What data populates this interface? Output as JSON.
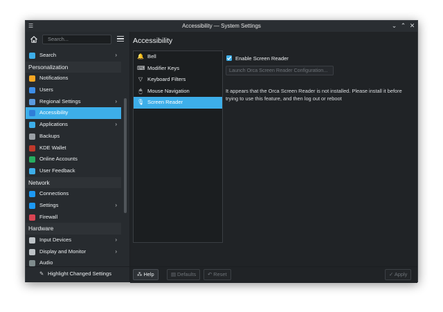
{
  "window": {
    "title": "Accessibility — System Settings"
  },
  "search": {
    "placeholder": "Search..."
  },
  "sidebar": {
    "items": [
      {
        "type": "item",
        "label": "Search",
        "icon": "search-icon",
        "color": "#3daee9",
        "chevron": true
      },
      {
        "type": "header",
        "label": "Personalization"
      },
      {
        "type": "item",
        "label": "Notifications",
        "icon": "bell-icon",
        "color": "#f6a623",
        "chevron": false
      },
      {
        "type": "item",
        "label": "Users",
        "icon": "users-icon",
        "color": "#3d8ee9",
        "chevron": false
      },
      {
        "type": "item",
        "label": "Regional Settings",
        "icon": "regional-icon",
        "color": "#5b9be0",
        "chevron": true
      },
      {
        "type": "item",
        "label": "Accessibility",
        "icon": "accessibility-icon",
        "color": "#2f7ed8",
        "chevron": false,
        "active": true
      },
      {
        "type": "item",
        "label": "Applications",
        "icon": "applications-icon",
        "color": "#3daee9",
        "chevron": true
      },
      {
        "type": "item",
        "label": "Backups",
        "icon": "backups-icon",
        "color": "#9aa0a6",
        "chevron": false
      },
      {
        "type": "item",
        "label": "KDE Wallet",
        "icon": "wallet-icon",
        "color": "#c0392b",
        "chevron": false
      },
      {
        "type": "item",
        "label": "Online Accounts",
        "icon": "online-accounts-icon",
        "color": "#27ae60",
        "chevron": false
      },
      {
        "type": "item",
        "label": "User Feedback",
        "icon": "feedback-icon",
        "color": "#3daee9",
        "chevron": false
      },
      {
        "type": "header",
        "label": "Network"
      },
      {
        "type": "item",
        "label": "Connections",
        "icon": "connections-icon",
        "color": "#1d99f3",
        "chevron": false
      },
      {
        "type": "item",
        "label": "Settings",
        "icon": "network-settings-icon",
        "color": "#1d99f3",
        "chevron": true
      },
      {
        "type": "item",
        "label": "Firewall",
        "icon": "firewall-icon",
        "color": "#da4453",
        "chevron": false
      },
      {
        "type": "header",
        "label": "Hardware"
      },
      {
        "type": "item",
        "label": "Input Devices",
        "icon": "input-devices-icon",
        "color": "#bdc3c7",
        "chevron": true
      },
      {
        "type": "item",
        "label": "Display and Monitor",
        "icon": "display-icon",
        "color": "#bdc3c7",
        "chevron": true
      },
      {
        "type": "item",
        "label": "Audio",
        "icon": "audio-icon",
        "color": "#7f8c8d",
        "chevron": false
      }
    ],
    "highlight_label": "Highlight Changed Settings"
  },
  "page": {
    "title": "Accessibility"
  },
  "subnav": [
    {
      "label": "Bell",
      "icon": "bell-icon",
      "glyph": "🔔"
    },
    {
      "label": "Modifier Keys",
      "icon": "keyboard-icon",
      "glyph": "⌨"
    },
    {
      "label": "Keyboard Filters",
      "icon": "filter-icon",
      "glyph": "▽"
    },
    {
      "label": "Mouse Navigation",
      "icon": "mouse-icon",
      "glyph": "🖱"
    },
    {
      "label": "Screen Reader",
      "icon": "microphone-icon",
      "glyph": "🎙",
      "active": true
    }
  ],
  "screen_reader": {
    "enable_label": "Enable Screen Reader",
    "enabled": true,
    "launch_label": "Launch Orca Screen Reader Configuration...",
    "info": "It appears that the Orca Screen Reader is not installed. Please install it before trying to use this feature, and then log out or reboot"
  },
  "buttons": {
    "help": "Help",
    "defaults": "Defaults",
    "reset": "Reset",
    "apply": "Apply"
  },
  "colors": {
    "accent": "#3daee9",
    "window_bg": "#202326"
  }
}
